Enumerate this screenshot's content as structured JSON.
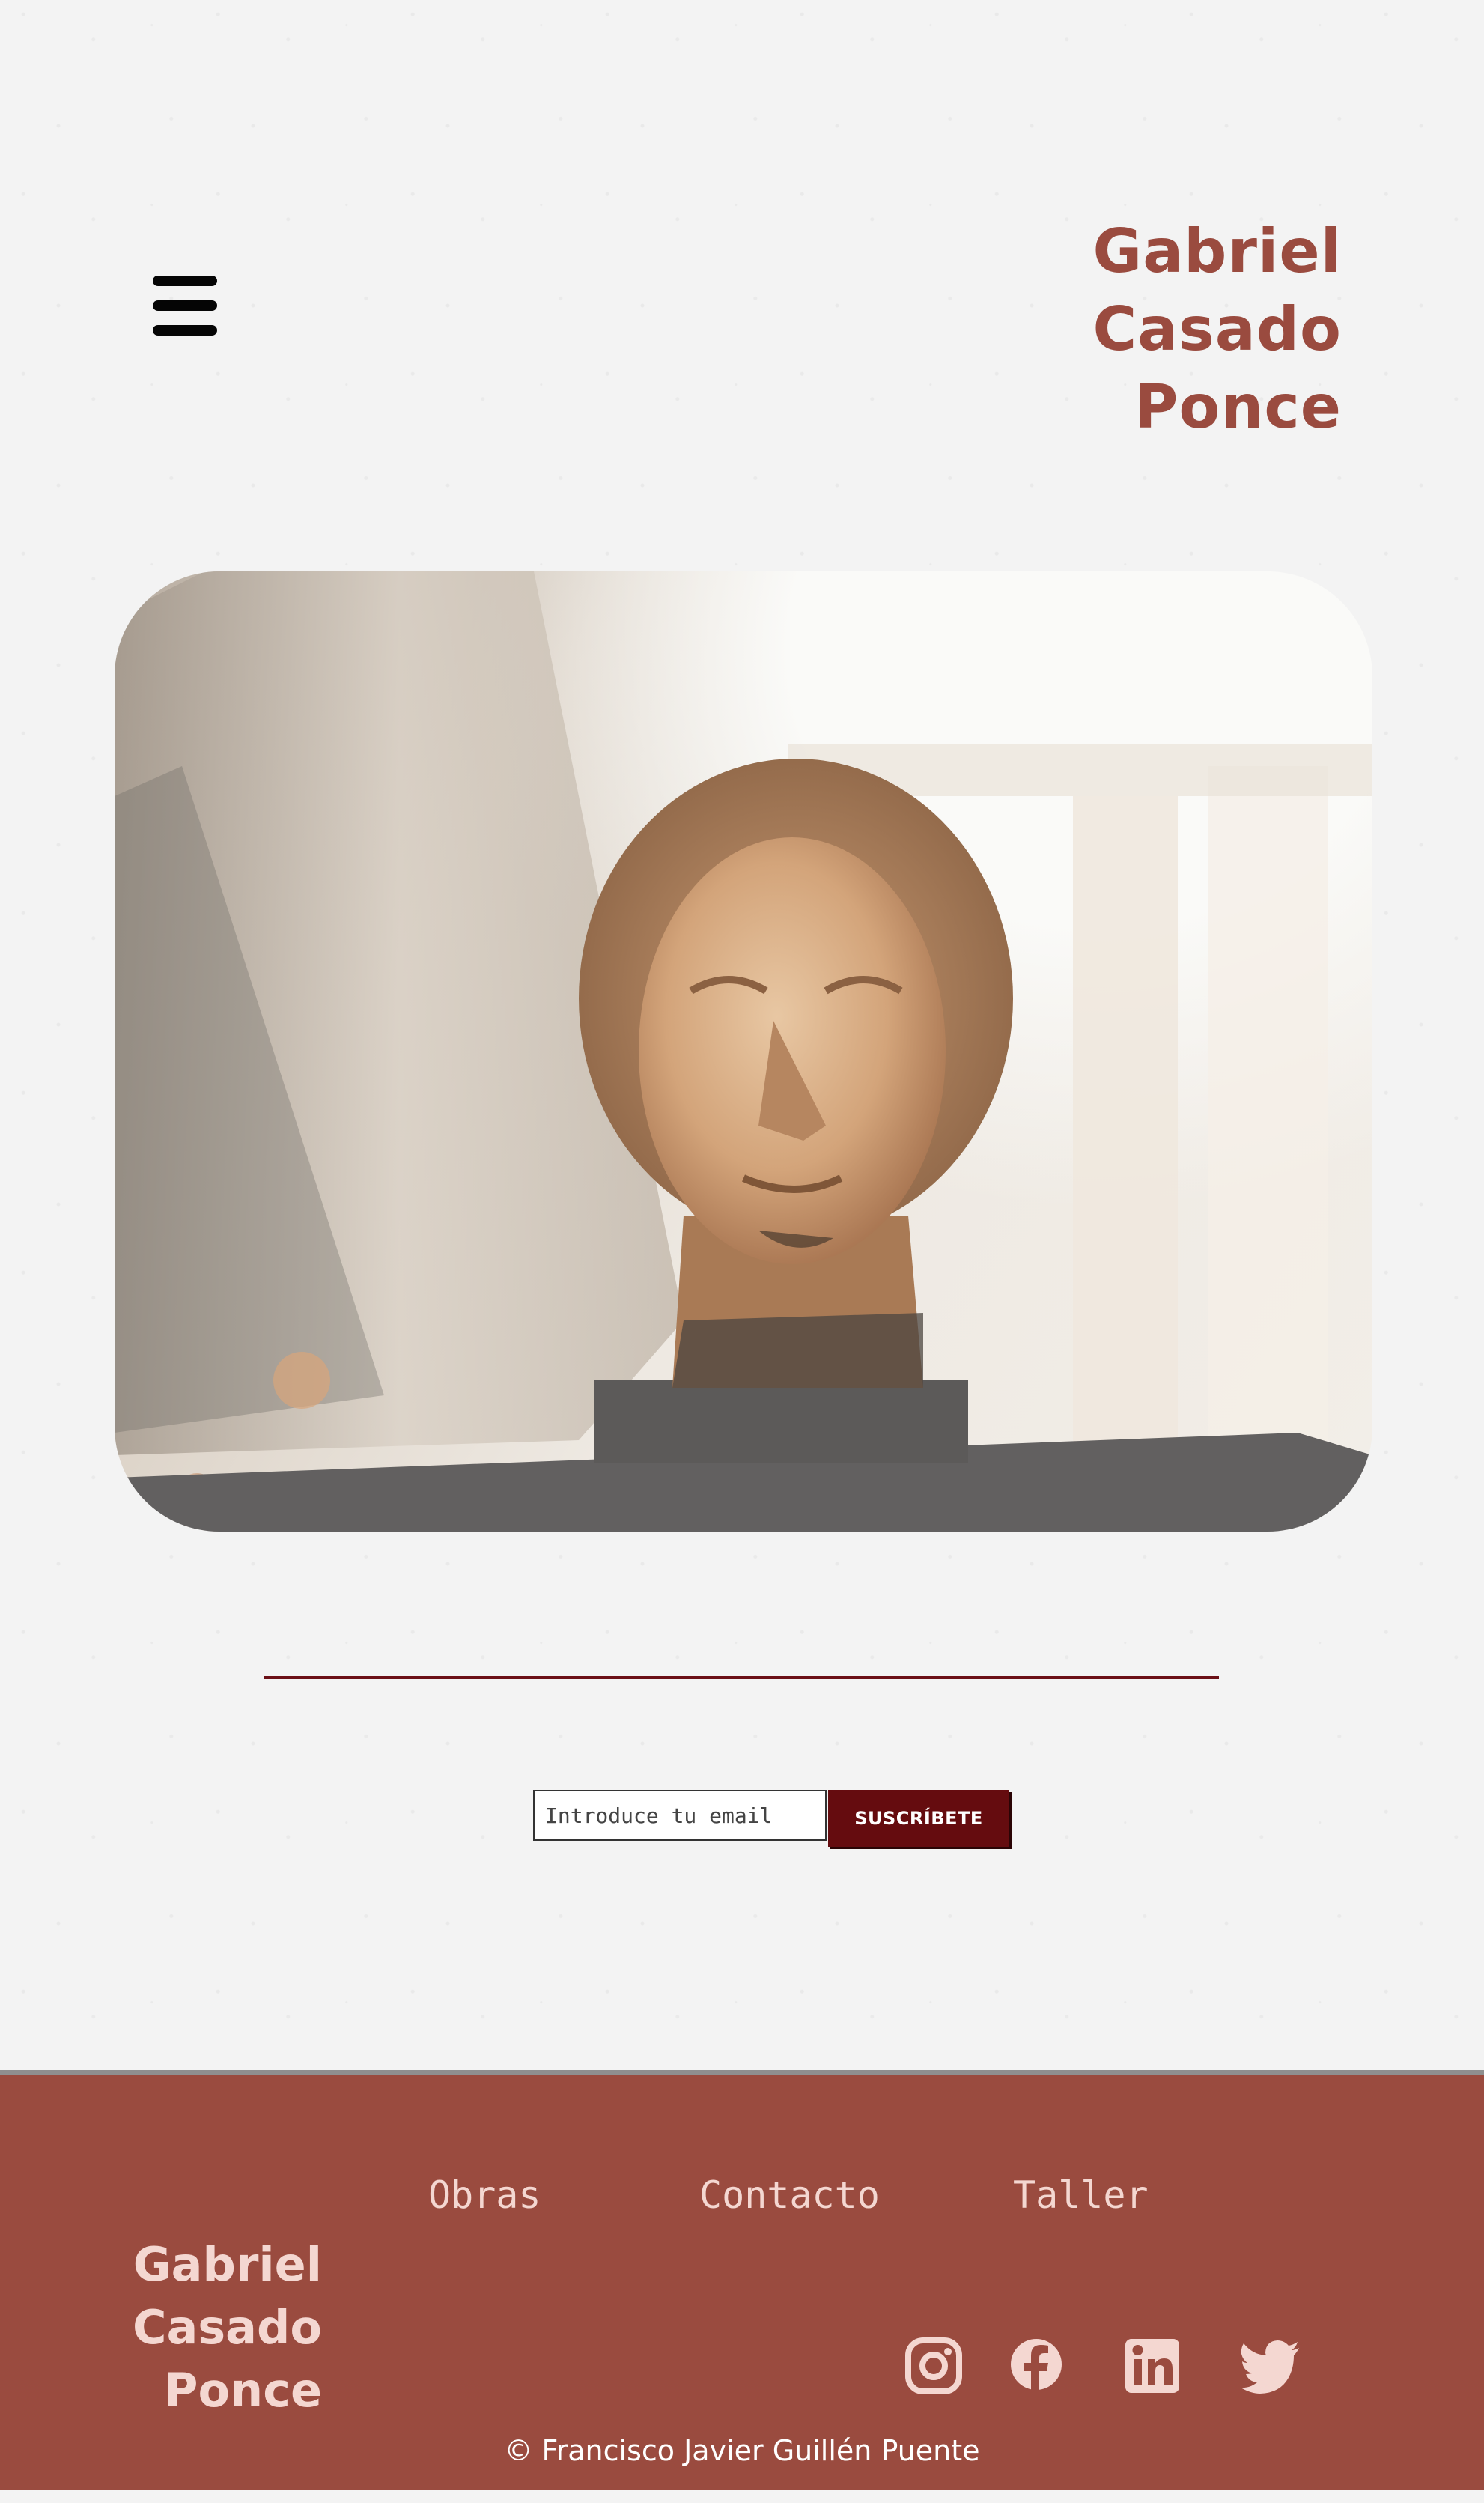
{
  "header": {
    "title_lines": [
      "Gabriel",
      "Casado",
      "Ponce"
    ],
    "menu_icon": "hamburger-menu-icon"
  },
  "hero": {
    "image_subject": "marble sculpture head"
  },
  "subscribe": {
    "email_placeholder": "Introduce tu email",
    "button_label": "SUSCRÍBETE"
  },
  "footer": {
    "title_lines": [
      "Gabriel",
      "Casado",
      "Ponce"
    ],
    "nav": [
      {
        "label": "Obras"
      },
      {
        "label": "Contacto"
      },
      {
        "label": "Taller"
      }
    ],
    "social": [
      {
        "icon": "instagram-icon"
      },
      {
        "icon": "facebook-icon"
      },
      {
        "icon": "linkedin-icon"
      },
      {
        "icon": "twitter-icon"
      }
    ],
    "copyright": "© Francisco Javier Guillén Puente"
  },
  "colors": {
    "background": "#f3f3f3",
    "brand": "#9a4b3f",
    "footer_text": "#f4d7d1",
    "button": "#650c0f",
    "divider": "#6b1017"
  }
}
